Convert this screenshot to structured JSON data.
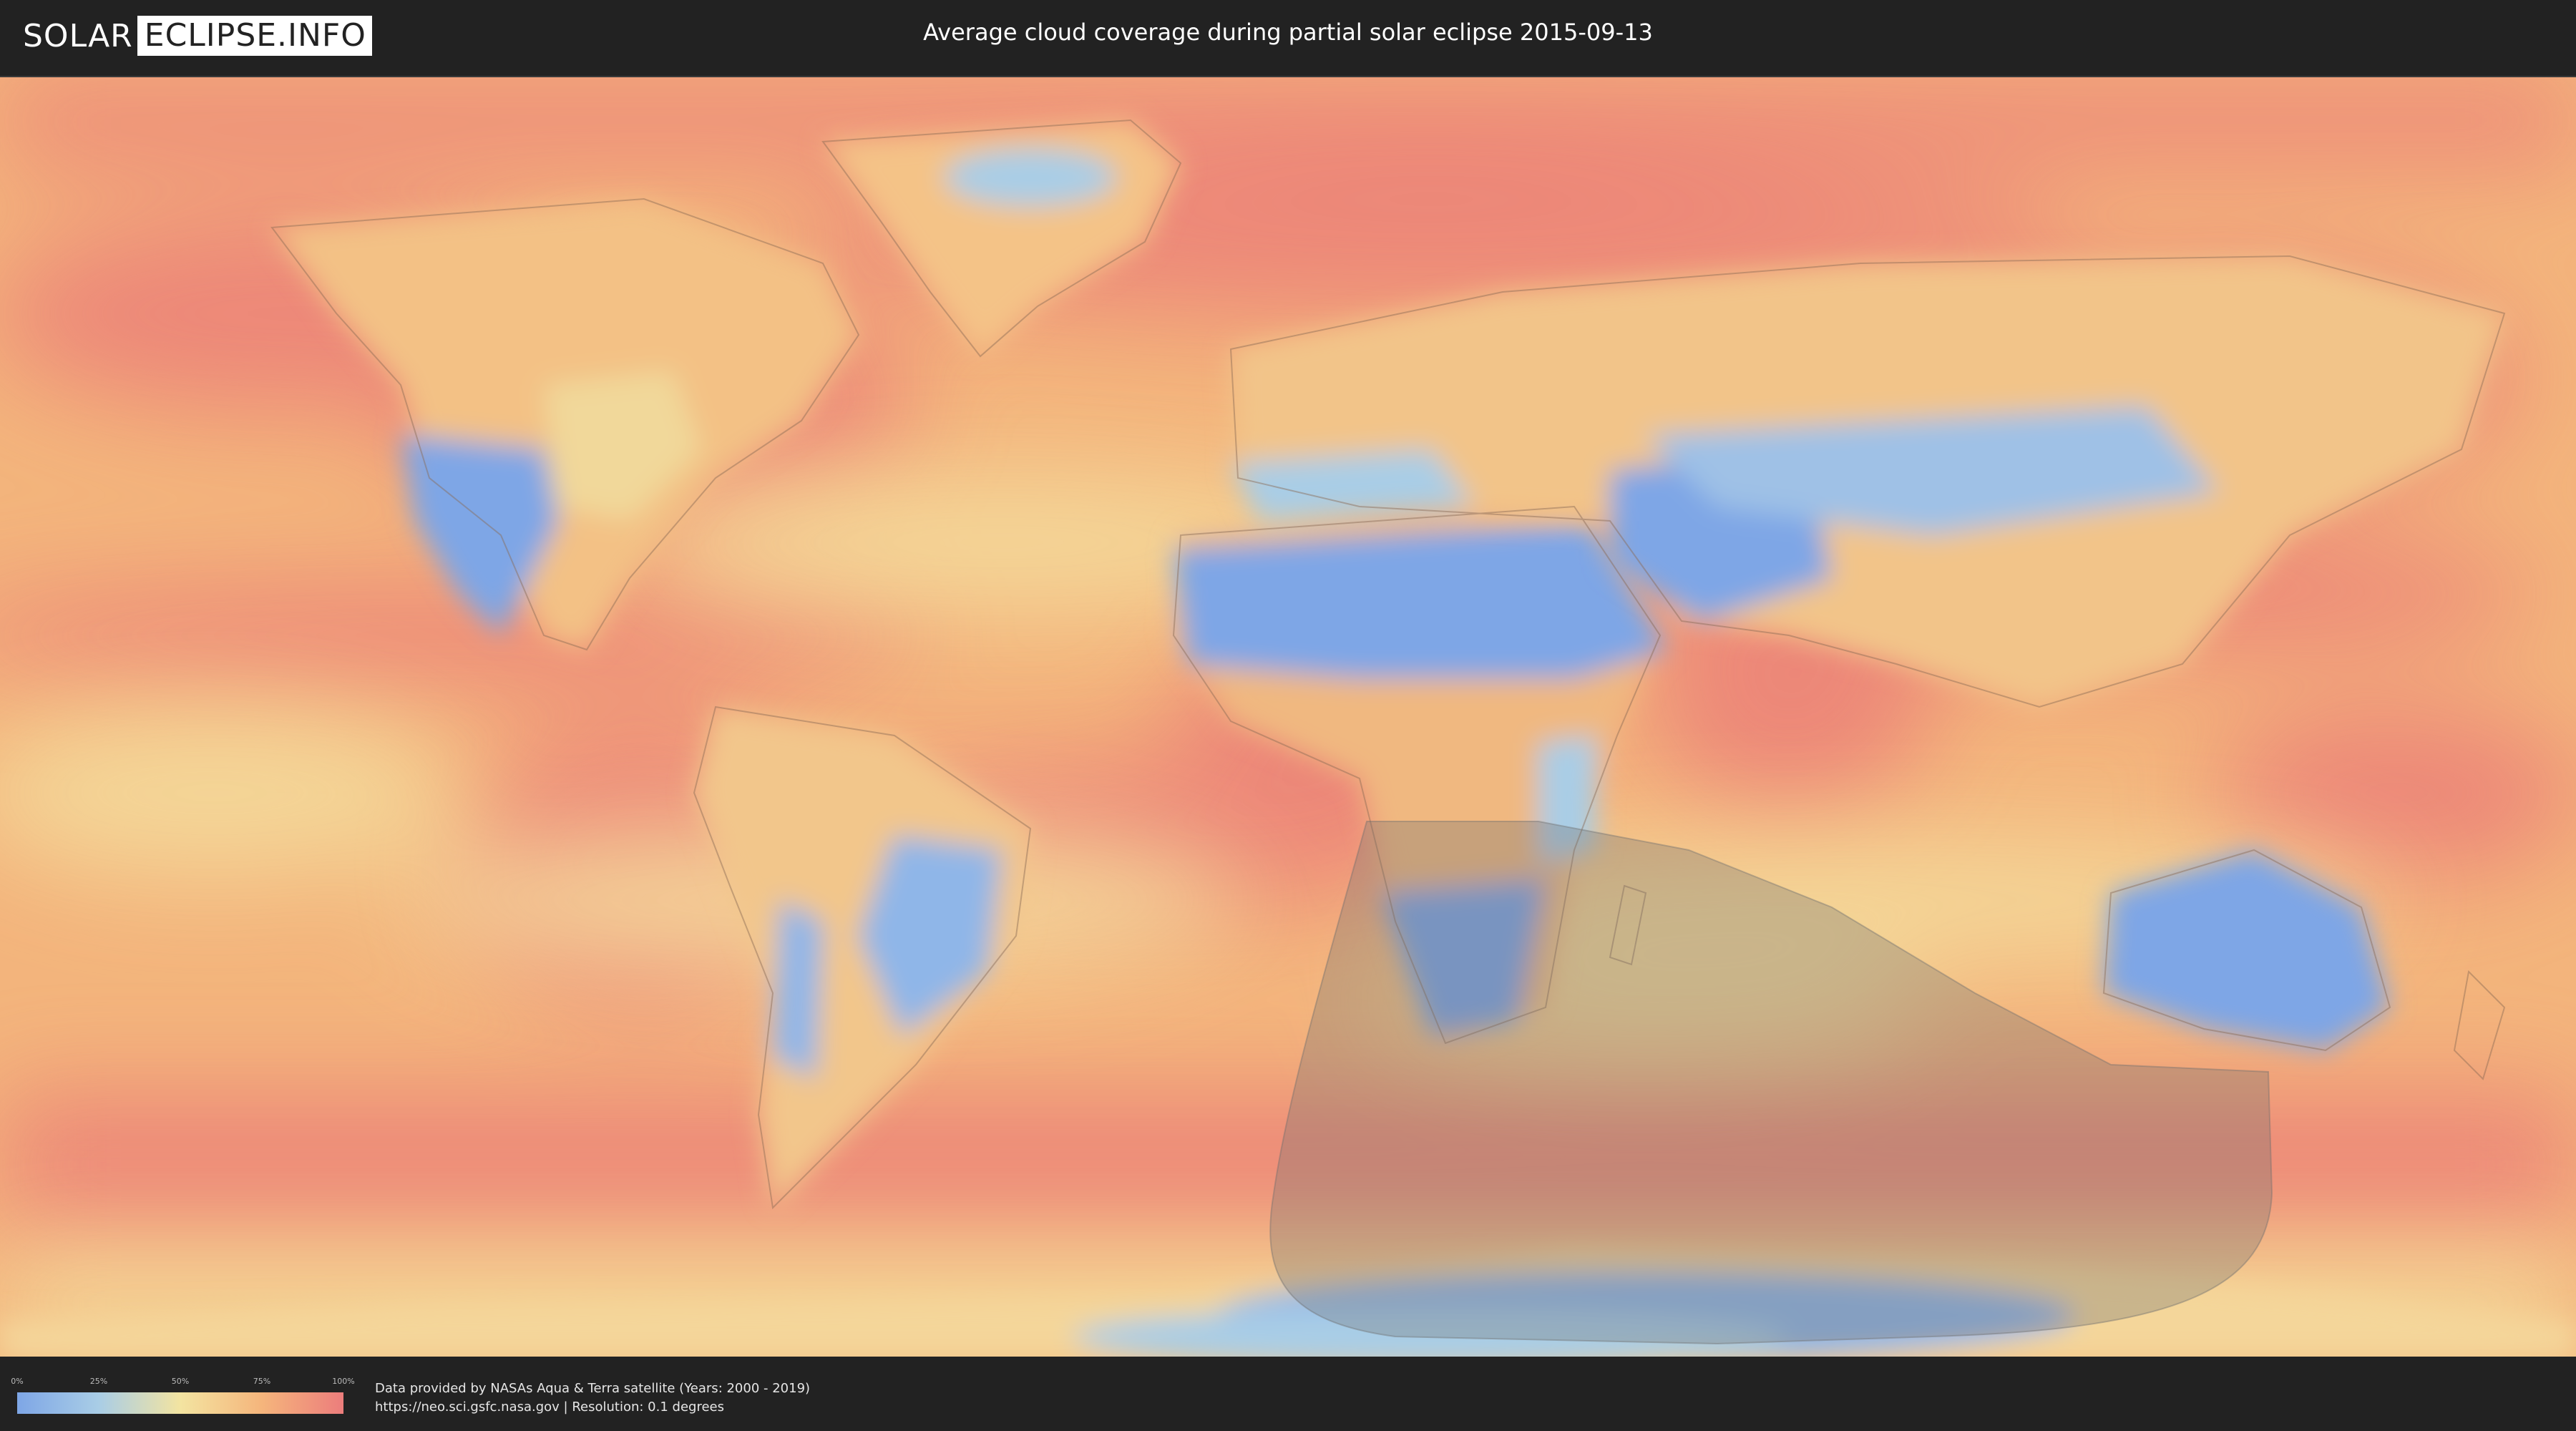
{
  "header": {
    "logo_left": "SOLAR",
    "logo_right": "ECLIPSE.INFO",
    "title": "Average cloud coverage during partial solar eclipse 2015-09-13"
  },
  "map": {
    "layer": "average cloud coverage",
    "eclipse_type": "partial",
    "date": "2015-09-13",
    "colors": {
      "clear": "#7ea6e6",
      "low": "#a9cde6",
      "mid": "#f3e4a1",
      "high": "#f5b57c",
      "overcast": "#ec7d7c",
      "eclipse_shadow": "#707070",
      "country_border": "#8a6a55"
    }
  },
  "legend": {
    "ticks": [
      "0%",
      "25%",
      "50%",
      "75%",
      "100%"
    ]
  },
  "footer": {
    "credit_line1": "Data provided by NASAs Aqua & Terra satellite (Years: 2000 - 2019)",
    "credit_line2": "https://neo.sci.gsfc.nasa.gov | Resolution: 0.1 degrees"
  }
}
